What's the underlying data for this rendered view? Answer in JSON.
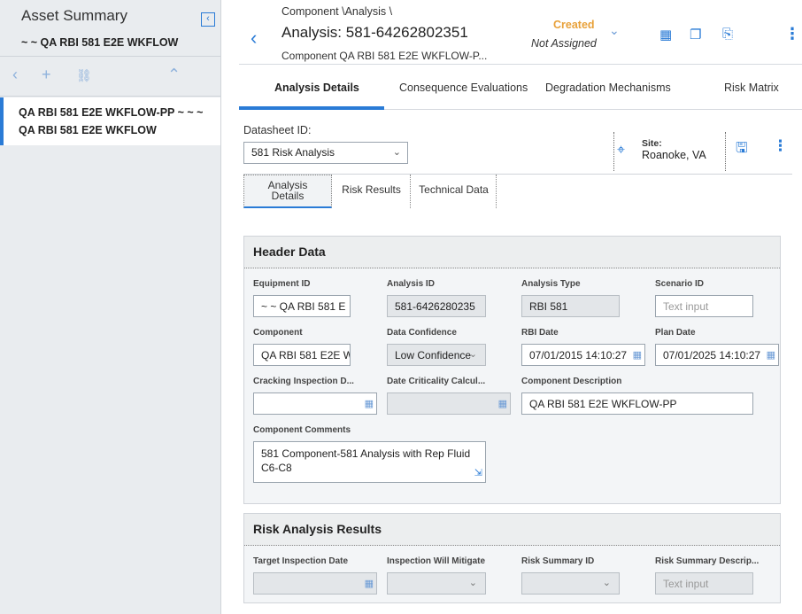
{
  "left_panel": {
    "title": "Asset Summary",
    "subtitle": "~ ~ QA RBI 581 E2E WKFLOW",
    "selected_item_line1": "QA RBI 581 E2E WKFLOW-PP ~ ~ ~",
    "selected_item_line2": "QA RBI 581 E2E WKFLOW"
  },
  "header": {
    "breadcrumb": "Component \\Analysis \\",
    "title": "Analysis: 581-64262802351",
    "subtitle": "Component QA RBI 581 E2E WKFLOW-P...",
    "state": "Created",
    "assignment": "Not Assigned"
  },
  "tabs": [
    "Analysis Details",
    "Consequence Evaluations",
    "Degradation Mechanisms",
    "Risk Matrix"
  ],
  "datasheet": {
    "label": "Datasheet ID:",
    "value": "581 Risk Analysis",
    "site_label": "Site:",
    "site_value": "Roanoke, VA"
  },
  "subtabs": [
    "Analysis\nDetails",
    "Risk Results",
    "Technical Data"
  ],
  "header_data": {
    "title": "Header Data",
    "equipment_id_label": "Equipment ID",
    "equipment_id_value": "~ ~ QA RBI 581 E",
    "analysis_id_label": "Analysis ID",
    "analysis_id_value": "581-6426280235",
    "analysis_type_label": "Analysis Type",
    "analysis_type_value": "RBI 581",
    "scenario_id_label": "Scenario ID",
    "scenario_id_placeholder": "Text input",
    "component_label": "Component",
    "component_value": "QA RBI 581 E2E W",
    "data_confidence_label": "Data Confidence",
    "data_confidence_value": "Low Confidence",
    "rbi_date_label": "RBI Date",
    "rbi_date_value": "07/01/2015 14:10:27",
    "plan_date_label": "Plan Date",
    "plan_date_value": "07/01/2025 14:10:27",
    "cracking_label": "Cracking Inspection D...",
    "date_crit_label": "Date Criticality Calcul...",
    "comp_desc_label": "Component Description",
    "comp_desc_value": "QA RBI 581 E2E WKFLOW-PP",
    "comp_comments_label": "Component Comments",
    "comp_comments_value": "581 Component-581 Analysis with Rep Fluid C6-C8"
  },
  "risk_results": {
    "title": "Risk Analysis Results",
    "target_label": "Target Inspection Date",
    "mitigate_label": "Inspection Will Mitigate",
    "summary_id_label": "Risk Summary ID",
    "summary_desc_label": "Risk Summary Descrip...",
    "summary_desc_placeholder": "Text input"
  }
}
